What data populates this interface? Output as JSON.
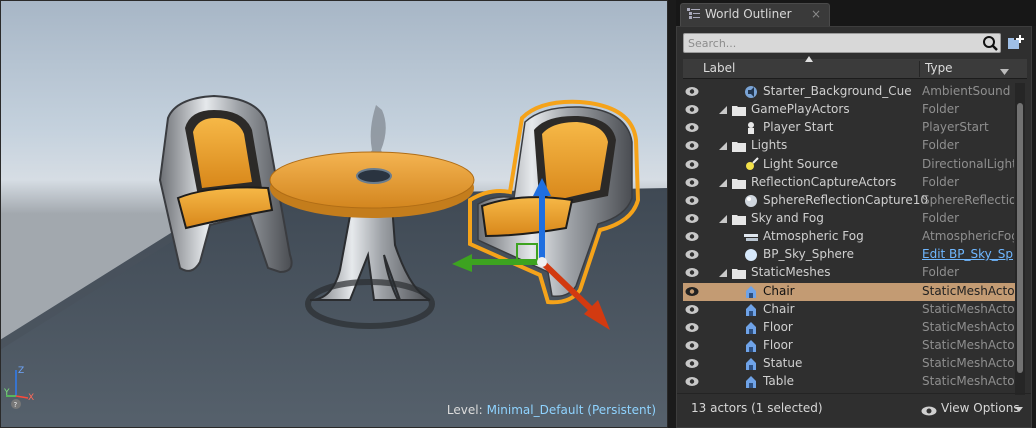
{
  "viewport": {
    "level_prefix": "Level:",
    "level_name": "Minimal_Default (Persistent)",
    "axis_labels": {
      "x": "X",
      "y": "Y",
      "z": "Z"
    }
  },
  "outliner": {
    "tab_title": "World Outliner",
    "tab_close": "×",
    "search_placeholder": "Search...",
    "columns": {
      "label": "Label",
      "type": "Type"
    },
    "rows": [
      {
        "label": "Starter_Background_Cue",
        "type": "AmbientSound",
        "indent": 2,
        "icon": "ambient-sound-icon",
        "folder": false,
        "selected": false
      },
      {
        "label": "GamePlayActors",
        "type": "Folder",
        "indent": 1,
        "icon": "folder-icon",
        "folder": true,
        "selected": false
      },
      {
        "label": "Player Start",
        "type": "PlayerStart",
        "indent": 2,
        "icon": "player-start-icon",
        "folder": false,
        "selected": false
      },
      {
        "label": "Lights",
        "type": "Folder",
        "indent": 1,
        "icon": "folder-icon",
        "folder": true,
        "selected": false
      },
      {
        "label": "Light Source",
        "type": "DirectionalLight",
        "indent": 2,
        "icon": "directional-light-icon",
        "folder": false,
        "selected": false
      },
      {
        "label": "ReflectionCaptureActors",
        "type": "Folder",
        "indent": 1,
        "icon": "folder-icon",
        "folder": true,
        "selected": false
      },
      {
        "label": "SphereReflectionCapture10",
        "type": "SphereReflection",
        "indent": 2,
        "icon": "reflection-capture-icon",
        "folder": false,
        "selected": false
      },
      {
        "label": "Sky and Fog",
        "type": "Folder",
        "indent": 1,
        "icon": "folder-icon",
        "folder": true,
        "selected": false
      },
      {
        "label": "Atmospheric Fog",
        "type": "AtmosphericFog",
        "indent": 2,
        "icon": "atmospheric-fog-icon",
        "folder": false,
        "selected": false
      },
      {
        "label": "BP_Sky_Sphere",
        "type": "Edit BP_Sky_Sp",
        "indent": 2,
        "icon": "sky-sphere-icon",
        "folder": false,
        "selected": false,
        "link": true
      },
      {
        "label": "StaticMeshes",
        "type": "Folder",
        "indent": 1,
        "icon": "folder-icon",
        "folder": true,
        "selected": false
      },
      {
        "label": "Chair",
        "type": "StaticMeshActor",
        "indent": 2,
        "icon": "static-mesh-icon",
        "folder": false,
        "selected": true
      },
      {
        "label": "Chair",
        "type": "StaticMeshActor",
        "indent": 2,
        "icon": "static-mesh-icon",
        "folder": false,
        "selected": false
      },
      {
        "label": "Floor",
        "type": "StaticMeshActor",
        "indent": 2,
        "icon": "static-mesh-icon",
        "folder": false,
        "selected": false
      },
      {
        "label": "Floor",
        "type": "StaticMeshActor",
        "indent": 2,
        "icon": "static-mesh-icon",
        "folder": false,
        "selected": false
      },
      {
        "label": "Statue",
        "type": "StaticMeshActor",
        "indent": 2,
        "icon": "static-mesh-icon",
        "folder": false,
        "selected": false
      },
      {
        "label": "Table",
        "type": "StaticMeshActor",
        "indent": 2,
        "icon": "static-mesh-icon",
        "folder": false,
        "selected": false
      }
    ],
    "footer": {
      "actor_count": "13 actors (1 selected)",
      "view_options": "View Options"
    }
  },
  "colors": {
    "selection": "#c39b73",
    "chair_orange": "#f0a528",
    "selection_outline": "#f5a31a",
    "gizmo_x": "#d23a10",
    "gizmo_y": "#3da320",
    "gizmo_z": "#1f6fe0",
    "link": "#6fb7ff"
  }
}
